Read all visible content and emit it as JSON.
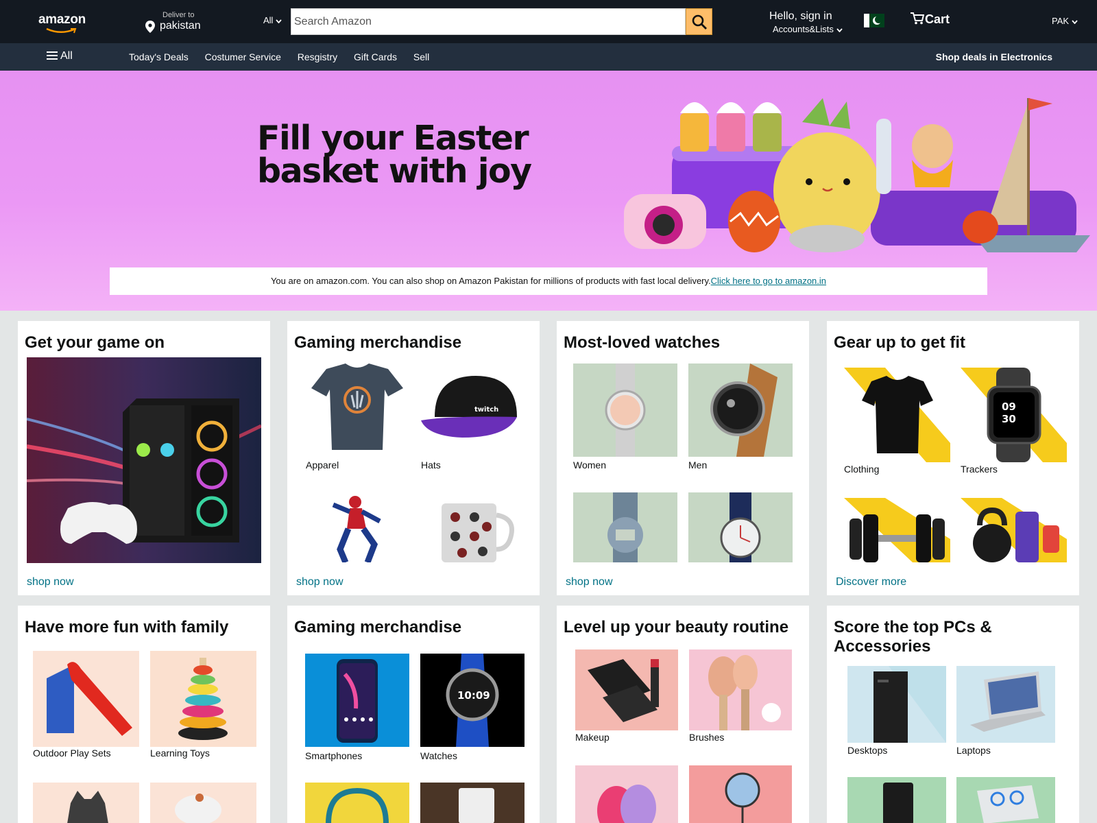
{
  "header": {
    "logo_text": "amazon",
    "deliver_label": "Deliver to",
    "deliver_location": "pakistan",
    "search_category": "All",
    "search_placeholder": "Search Amazon",
    "greeting": "Hello, sign in",
    "account_lists": "Accounts&Lists",
    "cart_label": "Cart",
    "country_code": "PAK"
  },
  "subnav": {
    "all_label": "All",
    "links": [
      "Today's Deals",
      "Costumer Service",
      "Resgistry",
      "Gift Cards",
      "Sell"
    ],
    "promo": "Shop deals in Electronics"
  },
  "hero": {
    "title_line1": "Fill your Easter",
    "title_line2": "basket with joy",
    "notice_text": "You are on amazon.com. You can also shop on Amazon Pakistan for millions of products with fast local delivery.",
    "notice_link": "Click here to go to amazon.in"
  },
  "cards": [
    {
      "title": "Get your game on",
      "cta": "shop now",
      "tiles": []
    },
    {
      "title": "Gaming merchandise",
      "cta": "shop now",
      "tiles": [
        "Apparel",
        "Hats",
        "",
        ""
      ]
    },
    {
      "title": "Most-loved watches",
      "cta": "shop now",
      "tiles": [
        "Women",
        "Men",
        "",
        ""
      ]
    },
    {
      "title": "Gear up to get fit",
      "cta": "Discover more",
      "tiles": [
        "Clothing",
        "Trackers",
        "",
        ""
      ]
    },
    {
      "title": "Have more fun with family",
      "tiles": [
        "Outdoor Play Sets",
        "Learning Toys",
        "",
        ""
      ]
    },
    {
      "title": "Gaming merchandise",
      "tiles": [
        "Smartphones",
        "Watches",
        "",
        ""
      ]
    },
    {
      "title": "Level up your beauty routine",
      "tiles": [
        "Makeup",
        "Brushes",
        "",
        ""
      ]
    },
    {
      "title": "Score the top PCs & Accessories",
      "tiles": [
        "Desktops",
        "Laptops",
        "",
        ""
      ]
    }
  ],
  "colors": {
    "nav_bg": "#131921",
    "subnav_bg": "#232f3e",
    "search_button": "#febd69",
    "hero_bg": "#eb98f5",
    "link": "#007185",
    "page_bg": "#e3e6e6"
  }
}
